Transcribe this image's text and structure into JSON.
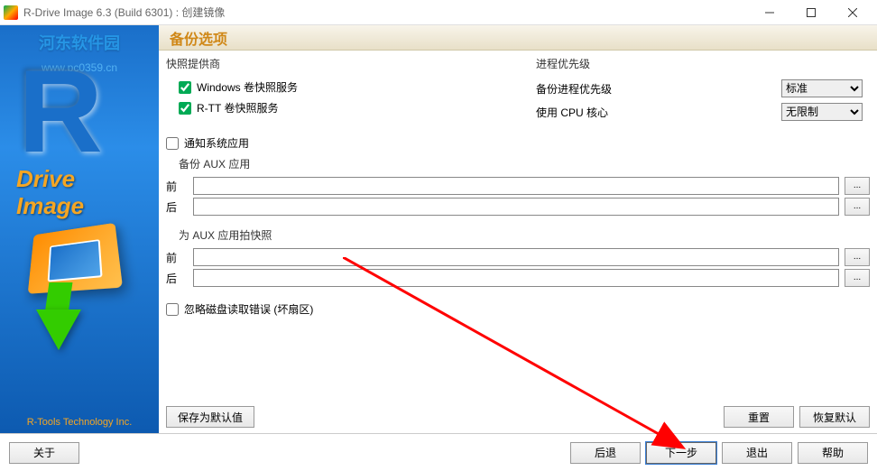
{
  "titlebar": {
    "title": "R-Drive Image 6.3 (Build 6301) : 创建镜像"
  },
  "sidebar": {
    "watermark": "河东软件园",
    "watermark_url": "www.pc0359.cn",
    "drive": "Drive",
    "image": "Image",
    "footer": "R-Tools Technology Inc."
  },
  "header": {
    "title": "备份选项"
  },
  "snapshot": {
    "provider_label": "快照提供商",
    "windows_check": "Windows 卷快照服务",
    "rtt_check": "R-TT 卷快照服务"
  },
  "priority": {
    "label": "进程优先级",
    "backup_label": "备份进程优先级",
    "backup_value": "标准",
    "cpu_label": "使用 CPU 核心",
    "cpu_value": "无限制"
  },
  "notify": {
    "label": "通知系统应用"
  },
  "aux_backup": {
    "label": "备份 AUX 应用",
    "before": "前",
    "after": "后"
  },
  "aux_snapshot": {
    "label": "为 AUX 应用拍快照",
    "before": "前",
    "after": "后"
  },
  "ignore": {
    "label": "忽略磁盘读取错误 (坏扇区)"
  },
  "options_buttons": {
    "save_default": "保存为默认值",
    "reset": "重置",
    "restore_default": "恢复默认"
  },
  "footer": {
    "about": "关于",
    "back": "后退",
    "next": "下一步",
    "exit": "退出",
    "help": "帮助"
  }
}
